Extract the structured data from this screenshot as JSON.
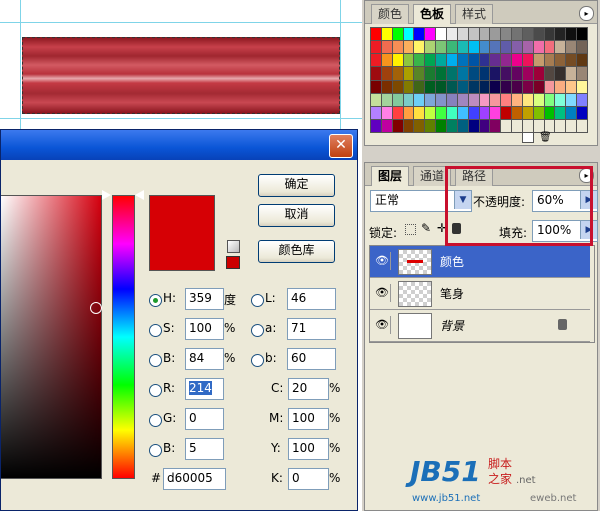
{
  "swatches_panel": {
    "tabs": [
      "颜色",
      "色板",
      "样式"
    ],
    "colors": [
      "#ff0000",
      "#ffff00",
      "#00ff00",
      "#00ffff",
      "#0000ff",
      "#ff00ff",
      "#ffffff",
      "#ebebeb",
      "#d7d7d7",
      "#c3c3c3",
      "#afafaf",
      "#9b9b9b",
      "#878787",
      "#737373",
      "#5f5f5f",
      "#4b4b4b",
      "#373737",
      "#232323",
      "#0f0f0f",
      "#000000",
      "#ee1c24",
      "#f26c4f",
      "#f68e55",
      "#fbaf5c",
      "#fff467",
      "#acd372",
      "#7cc576",
      "#3bb878",
      "#1abbb4",
      "#00bff3",
      "#438ccb",
      "#5574b9",
      "#605ca8",
      "#855fa8",
      "#a763a8",
      "#f06ea9",
      "#f26d7d",
      "#c7b299",
      "#998675",
      "#736357",
      "#ed1c24",
      "#f7941d",
      "#fff200",
      "#8dc63f",
      "#39b54a",
      "#00a651",
      "#00a99d",
      "#00aeef",
      "#0072bc",
      "#0054a6",
      "#2e3192",
      "#662d91",
      "#92278f",
      "#ec008c",
      "#ed145b",
      "#c69c6d",
      "#a67c52",
      "#8c6239",
      "#754c24",
      "#603913",
      "#9e0b0f",
      "#a0410d",
      "#a36209",
      "#aba000",
      "#598527",
      "#1a7b30",
      "#007236",
      "#00746b",
      "#0076a3",
      "#004a80",
      "#003471",
      "#1b1464",
      "#440e62",
      "#630460",
      "#9e005d",
      "#9e0039",
      "#534741",
      "#362f2d",
      "#c7b299",
      "#998675",
      "#790000",
      "#7b2e00",
      "#7d4900",
      "#827b00",
      "#406618",
      "#005e20",
      "#005826",
      "#005952",
      "#005b7f",
      "#003663",
      "#002157",
      "#0d004c",
      "#32004b",
      "#4b0049",
      "#7b0046",
      "#7a0026",
      "#f5989d",
      "#f9ad81",
      "#fdc68a",
      "#fff79a",
      "#c4df9b",
      "#a3d39c",
      "#82ca9d",
      "#7accc8",
      "#6dcff6",
      "#7da7d9",
      "#8393ca",
      "#8781bd",
      "#a186be",
      "#bd8cbf",
      "#f49ac2",
      "#f6989d",
      "#ff8080",
      "#ffb380",
      "#ffe680",
      "#d9ff80",
      "#80ff80",
      "#80ffd9",
      "#80d9ff",
      "#8080ff",
      "#b380ff",
      "#ff80e6",
      "#ff4040",
      "#ff9f40",
      "#ffdf40",
      "#bfff40",
      "#40ff40",
      "#40ffbf",
      "#40bfff",
      "#4040ff",
      "#9f40ff",
      "#ff40df",
      "#c00000",
      "#c06000",
      "#c0a000",
      "#80c000",
      "#00c000",
      "#00c080",
      "#0080c0",
      "#0000c0",
      "#6000c0",
      "#c000a0",
      "#800000",
      "#804000",
      "#806000",
      "#608000",
      "#008000",
      "#008060",
      "#006080",
      "#000080",
      "#400080",
      "#800060",
      "#ece9d8",
      "#ece9d8",
      "#ece9d8",
      "#ece9d8",
      "#ece9d8",
      "#ece9d8",
      "#ece9d8",
      "#ece9d8"
    ]
  },
  "layers_panel": {
    "tabs": [
      "图层",
      "通道",
      "路径"
    ],
    "blend_mode": "正常",
    "opacity_label": "不透明度:",
    "opacity_value": "60%",
    "lock_label": "锁定:",
    "fill_label": "填充:",
    "fill_value": "100%",
    "layers": [
      {
        "name": "颜色",
        "selected": true
      },
      {
        "name": "笔身",
        "selected": false
      },
      {
        "name": "背景",
        "selected": false
      }
    ]
  },
  "color_picker": {
    "close_glyph": "✕",
    "buttons": {
      "ok": "确定",
      "cancel": "取消",
      "library": "颜色库"
    },
    "new_color": "#d60005",
    "hsb": {
      "h_label": "H:",
      "h": "359",
      "h_unit": "度",
      "s_label": "S:",
      "s": "100",
      "s_unit": "%",
      "b_label": "B:",
      "b": "84",
      "b_unit": "%"
    },
    "lab": {
      "l_label": "L:",
      "l": "46",
      "a_label": "a:",
      "a": "71",
      "b_label": "b:",
      "b": "60"
    },
    "rgb": {
      "r_label": "R:",
      "r": "214",
      "g_label": "G:",
      "g": "0",
      "b_label": "B:",
      "b": "5"
    },
    "cmyk": {
      "c_label": "C:",
      "c": "20",
      "m_label": "M:",
      "m": "100",
      "y_label": "Y:",
      "y": "100",
      "k_label": "K:",
      "k": "0",
      "unit": "%"
    },
    "hex_label": "#",
    "hex": "d60005"
  },
  "watermark": {
    "logo": "JB51",
    "tld": ".net",
    "cn_1": "脚本",
    "cn_2": "之家",
    "url": "www.jb51.net",
    "brand2": "eweb.net"
  }
}
